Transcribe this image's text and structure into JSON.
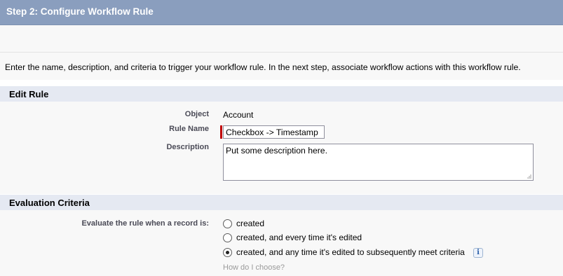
{
  "step_header": {
    "title": "Step 2: Configure Workflow Rule"
  },
  "intro": {
    "text": "Enter the name, description, and criteria to trigger your workflow rule. In the next step, associate workflow actions with this workflow rule."
  },
  "edit_rule": {
    "section_title": "Edit Rule",
    "object_label": "Object",
    "object_value": "Account",
    "rule_name_label": "Rule Name",
    "rule_name_value": "Checkbox -> Timestamp",
    "description_label": "Description",
    "description_value": "Put some description here."
  },
  "evaluation": {
    "section_title": "Evaluation Criteria",
    "label": "Evaluate the rule when a record is:",
    "options": [
      {
        "label": "created",
        "selected": false
      },
      {
        "label": "created, and every time it's edited",
        "selected": false
      },
      {
        "label": "created, and any time it's edited to subsequently meet criteria",
        "selected": true
      }
    ],
    "info_icon": "i",
    "help_link": "How do I choose?"
  },
  "colors": {
    "header_bg": "#8a9ebe",
    "section_header_bg": "#e5e9f2",
    "required_marker": "#c00000",
    "body_bg": "#f8f8f8"
  },
  "icons": [
    "radio-button",
    "info-icon",
    "resize-grip-icon"
  ]
}
